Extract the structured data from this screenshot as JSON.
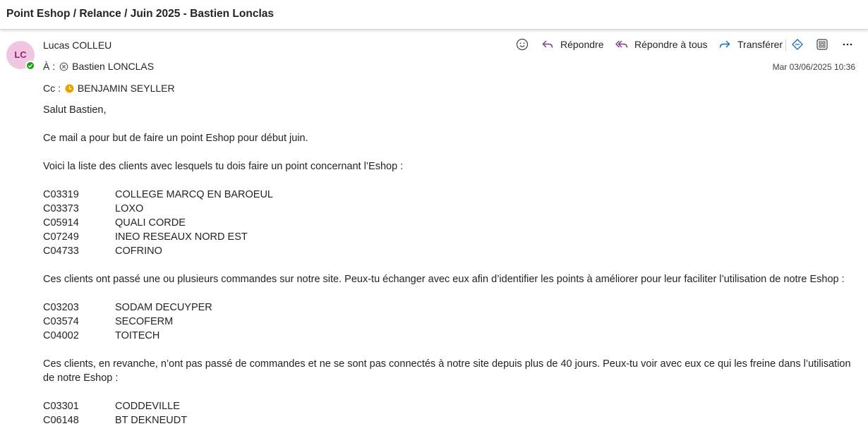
{
  "subject": "Point Eshop / Relance / Juin 2025 - Bastien Lonclas",
  "sender": {
    "initials": "LC",
    "name": "Lucas COLLEU",
    "avatar_bg": "#f1c6e3",
    "presence": "available"
  },
  "to": {
    "label": "À :",
    "name": "Bastien LONCLAS",
    "icon": "blocked-status-icon"
  },
  "cc": {
    "label": "Cc :",
    "name": "BENJAMIN SEYLLER",
    "icon": "away-clock-icon"
  },
  "date": "Mar 03/06/2025 10:36",
  "actions": {
    "emoji": "emoji-icon",
    "reply": "Répondre",
    "reply_all": "Répondre à tous",
    "forward": "Transférer",
    "extension": "extension-icon",
    "apps": "apps-icon",
    "more": "more-icon"
  },
  "body": {
    "greeting": "Salut Bastien,",
    "intro": "Ce mail a pour but de faire un point Eshop pour début juin.",
    "list_intro": "Voici la liste des clients avec lesquels tu dois faire un point concernant l’Eshop :",
    "list1": [
      {
        "code": "C03319",
        "name": "COLLEGE MARCQ EN BAROEUL"
      },
      {
        "code": "C03373",
        "name": "LOXO"
      },
      {
        "code": "C05914",
        "name": "QUALI CORDE"
      },
      {
        "code": "C07249",
        "name": "INEO RESEAUX NORD EST"
      },
      {
        "code": "C04733",
        "name": "COFRINO"
      }
    ],
    "para1": "Ces clients ont passé une ou plusieurs commandes sur notre site. Peux-tu échanger avec eux afin d’identifier les points à améliorer pour leur faciliter l’utilisation de notre Eshop :",
    "list2": [
      {
        "code": "C03203",
        "name": "SODAM DECUYPER"
      },
      {
        "code": "C03574",
        "name": "SECOFERM"
      },
      {
        "code": "C04002",
        "name": "TOITECH"
      }
    ],
    "para2": "Ces clients, en revanche, n’ont pas passé de commandes et ne se sont pas connectés à notre site depuis plus de 40 jours. Peux-tu voir avec eux ce qui les freine dans l’utilisation de notre Eshop :",
    "list3": [
      {
        "code": "C03301",
        "name": "CODDEVILLE"
      },
      {
        "code": "C06148",
        "name": "BT DEKNEUDT"
      }
    ]
  }
}
